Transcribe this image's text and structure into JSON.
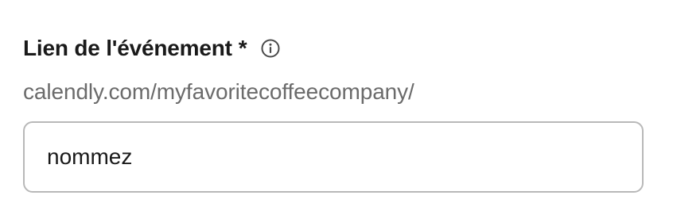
{
  "field": {
    "label": "Lien de l'événement",
    "required_mark": "*",
    "info_icon": "info-icon",
    "url_prefix": "calendly.com/myfavoritecoffeecompany/",
    "input_value": "nommez"
  },
  "colors": {
    "label": "#1a1a1a",
    "prefix_text": "#6b6b6b",
    "input_border": "#b8b8b8",
    "icon": "#4a4a4a"
  }
}
